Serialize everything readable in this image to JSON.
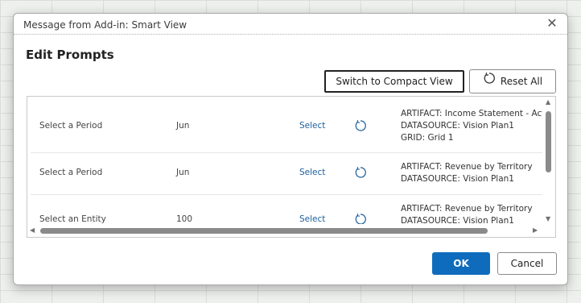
{
  "window": {
    "title": "Message from Add-in: Smart View",
    "close_icon": "close-icon"
  },
  "dialog": {
    "title": "Edit Prompts"
  },
  "toolbar": {
    "compact_label": "Switch to Compact View",
    "reset_label": "Reset All",
    "reset_icon": "refresh-icon"
  },
  "rows": [
    {
      "prompt": "Select a Period",
      "value": "Jun",
      "link": "Select",
      "info": [
        "ARTIFACT: Income Statement - Act vs",
        "DATASOURCE: Vision Plan1",
        "GRID: Grid 1"
      ]
    },
    {
      "prompt": "Select a Period",
      "value": "Jun",
      "link": "Select",
      "info": [
        "ARTIFACT: Revenue by Territory",
        "DATASOURCE: Vision Plan1"
      ]
    },
    {
      "prompt": "Select an Entity",
      "value": "100",
      "link": "Select",
      "info": [
        "ARTIFACT: Revenue by Territory",
        "DATASOURCE: Vision Plan1"
      ]
    }
  ],
  "footer": {
    "ok_label": "OK",
    "cancel_label": "Cancel"
  }
}
